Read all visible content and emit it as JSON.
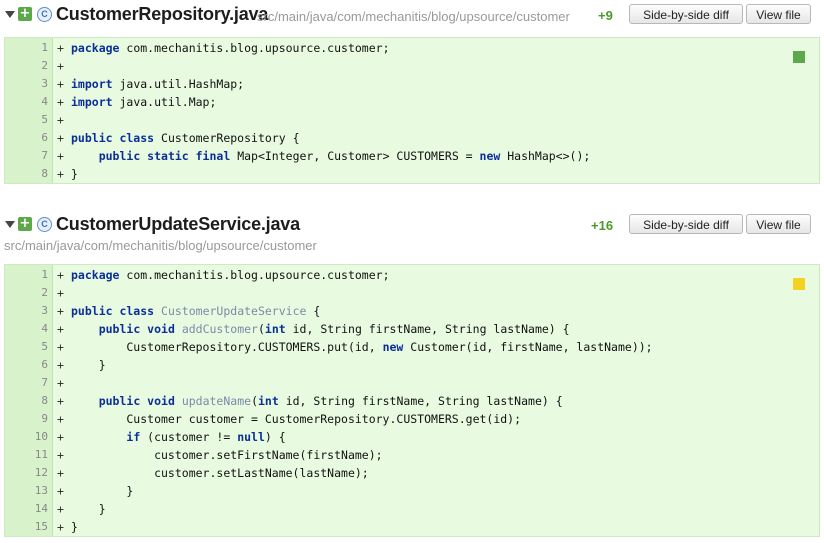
{
  "files": [
    {
      "name": "CustomerRepository.java",
      "path": "src/main/java/com/mechanitis/blog/upsource/customer",
      "added": "+9",
      "side_by_side_label": "Side-by-side diff",
      "view_file_label": "View file",
      "class_icon_letter": "C",
      "marker_color": "#5ca84a",
      "lines": [
        {
          "n": "1",
          "m": "+",
          "t": [
            [
              "kw",
              "package"
            ],
            [
              "p",
              " com.mechanitis.blog.upsource.customer;"
            ]
          ]
        },
        {
          "n": "2",
          "m": "+",
          "t": []
        },
        {
          "n": "3",
          "m": "+",
          "t": [
            [
              "kw",
              "import"
            ],
            [
              "p",
              " java.util.HashMap;"
            ]
          ]
        },
        {
          "n": "4",
          "m": "+",
          "t": [
            [
              "kw",
              "import"
            ],
            [
              "p",
              " java.util.Map;"
            ]
          ]
        },
        {
          "n": "5",
          "m": "+",
          "t": []
        },
        {
          "n": "6",
          "m": "+",
          "t": [
            [
              "kw",
              "public class"
            ],
            [
              "p",
              " CustomerRepository {"
            ]
          ]
        },
        {
          "n": "7",
          "m": "+",
          "t": [
            [
              "p",
              "    "
            ],
            [
              "kw",
              "public static final"
            ],
            [
              "p",
              " Map<Integer, Customer> CUSTOMERS = "
            ],
            [
              "kw",
              "new"
            ],
            [
              "p",
              " HashMap<>();"
            ]
          ]
        },
        {
          "n": "8",
          "m": "+",
          "t": [
            [
              "p",
              "}"
            ]
          ]
        }
      ]
    },
    {
      "name": "CustomerUpdateService.java",
      "path": "src/main/java/com/mechanitis/blog/upsource/customer",
      "added": "+16",
      "side_by_side_label": "Side-by-side diff",
      "view_file_label": "View file",
      "class_icon_letter": "C",
      "marker_color": "#f2d321",
      "lines": [
        {
          "n": "1",
          "m": "+",
          "t": [
            [
              "kw",
              "package"
            ],
            [
              "p",
              " com.mechanitis.blog.upsource.customer;"
            ]
          ]
        },
        {
          "n": "2",
          "m": "+",
          "t": []
        },
        {
          "n": "3",
          "m": "+",
          "t": [
            [
              "kw",
              "public class"
            ],
            [
              "p",
              " "
            ],
            [
              "mth",
              "CustomerUpdateService"
            ],
            [
              "p",
              " {"
            ]
          ]
        },
        {
          "n": "4",
          "m": "+",
          "t": [
            [
              "p",
              "    "
            ],
            [
              "kw",
              "public void"
            ],
            [
              "p",
              " "
            ],
            [
              "mth",
              "addCustomer"
            ],
            [
              "p",
              "("
            ],
            [
              "kw",
              "int"
            ],
            [
              "p",
              " id, String firstName, String lastName) {"
            ]
          ]
        },
        {
          "n": "5",
          "m": "+",
          "t": [
            [
              "p",
              "        CustomerRepository.CUSTOMERS.put(id, "
            ],
            [
              "kw",
              "new"
            ],
            [
              "p",
              " Customer(id, firstName, lastName));"
            ]
          ]
        },
        {
          "n": "6",
          "m": "+",
          "t": [
            [
              "p",
              "    }"
            ]
          ]
        },
        {
          "n": "7",
          "m": "+",
          "t": []
        },
        {
          "n": "8",
          "m": "+",
          "t": [
            [
              "p",
              "    "
            ],
            [
              "kw",
              "public void"
            ],
            [
              "p",
              " "
            ],
            [
              "mth",
              "updateName"
            ],
            [
              "p",
              "("
            ],
            [
              "kw",
              "int"
            ],
            [
              "p",
              " id, String firstName, String lastName) {"
            ]
          ]
        },
        {
          "n": "9",
          "m": "+",
          "t": [
            [
              "p",
              "        Customer customer = CustomerRepository.CUSTOMERS.get(id);"
            ]
          ]
        },
        {
          "n": "10",
          "m": "+",
          "t": [
            [
              "p",
              "        "
            ],
            [
              "kw",
              "if"
            ],
            [
              "p",
              " (customer != "
            ],
            [
              "kw",
              "null"
            ],
            [
              "p",
              ") {"
            ]
          ]
        },
        {
          "n": "11",
          "m": "+",
          "t": [
            [
              "p",
              "            customer.setFirstName(firstName);"
            ]
          ]
        },
        {
          "n": "12",
          "m": "+",
          "t": [
            [
              "p",
              "            customer.setLastName(lastName);"
            ]
          ]
        },
        {
          "n": "13",
          "m": "+",
          "t": [
            [
              "p",
              "        }"
            ]
          ]
        },
        {
          "n": "14",
          "m": "+",
          "t": [
            [
              "p",
              "    }"
            ]
          ]
        },
        {
          "n": "15",
          "m": "+",
          "t": [
            [
              "p",
              "}"
            ]
          ]
        }
      ]
    }
  ]
}
